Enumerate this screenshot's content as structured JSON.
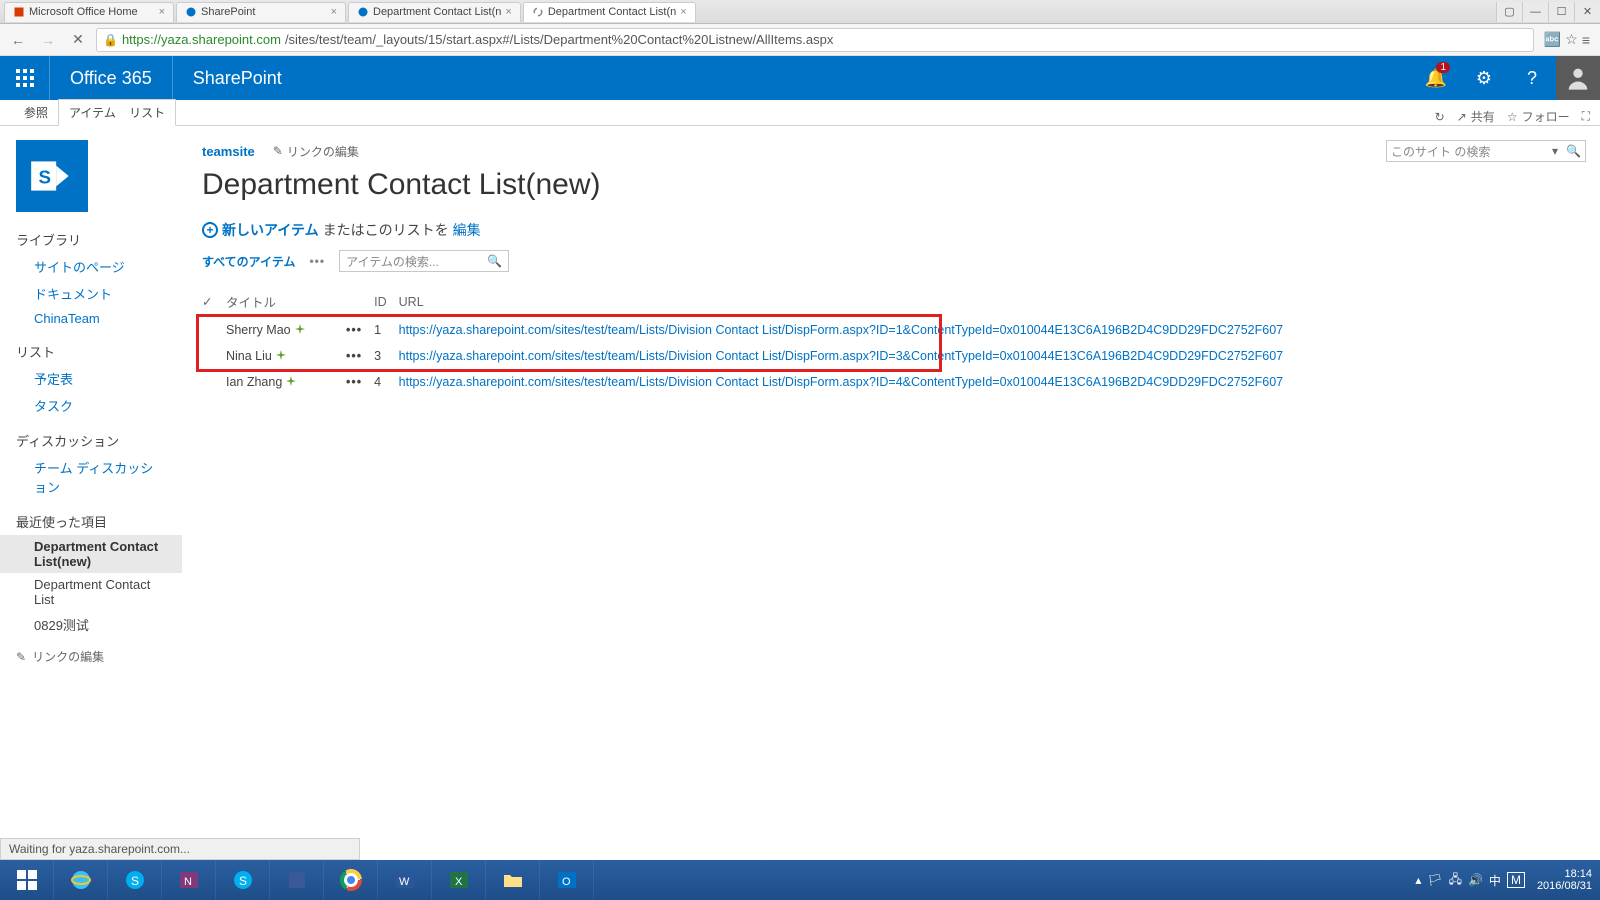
{
  "browser": {
    "tabs": [
      {
        "label": "Microsoft Office Home",
        "icon": "office"
      },
      {
        "label": "SharePoint",
        "icon": "sp"
      },
      {
        "label": "Department Contact List(n",
        "icon": "sp"
      },
      {
        "label": "Department Contact List(n",
        "icon": "loading",
        "active": true
      }
    ],
    "url_host": "https://yaza.sharepoint.com",
    "url_path": "/sites/test/team/_layouts/15/start.aspx#/Lists/Department%20Contact%20Listnew/AllItems.aspx",
    "status_text": "Waiting for yaza.sharepoint.com..."
  },
  "suite": {
    "brand": "Office 365",
    "app": "SharePoint",
    "notif_count": "1"
  },
  "ribbon": {
    "tabs": [
      "参照",
      "アイテム",
      "リスト"
    ],
    "share": "共有",
    "follow": "フォロー"
  },
  "breadcrumb": {
    "site": "teamsite",
    "edit_links": "リンクの編集"
  },
  "page_title": "Department Contact List(new)",
  "site_search_placeholder": "このサイト の検索",
  "new_item": {
    "link": "新しいアイテム",
    "middle": "またはこのリストを",
    "edit": "編集"
  },
  "views": {
    "current": "すべてのアイテム",
    "item_search_placeholder": "アイテムの検索..."
  },
  "left_nav": {
    "h_library": "ライブラリ",
    "lib_items": [
      "サイトのページ",
      "ドキュメント",
      "ChinaTeam"
    ],
    "h_list": "リスト",
    "list_items": [
      "予定表",
      "タスク"
    ],
    "h_discussion": "ディスカッション",
    "disc_items": [
      "チーム ディスカッション"
    ],
    "h_recent": "最近使った項目",
    "recent_items": [
      "Department Contact List(new)",
      "Department Contact List",
      "0829测试"
    ],
    "edit_links": "リンクの編集"
  },
  "list": {
    "cols": {
      "check": "✓",
      "title": "タイトル",
      "id": "ID",
      "url": "URL"
    },
    "rows": [
      {
        "title": "Sherry Mao",
        "id": "1",
        "url": "https://yaza.sharepoint.com/sites/test/team/Lists/Division Contact List/DispForm.aspx?ID=1&ContentTypeId=0x010044E13C6A196B2D4C9DD29FDC2752F607"
      },
      {
        "title": "Nina Liu",
        "id": "3",
        "url": "https://yaza.sharepoint.com/sites/test/team/Lists/Division Contact List/DispForm.aspx?ID=3&ContentTypeId=0x010044E13C6A196B2D4C9DD29FDC2752F607"
      },
      {
        "title": "Ian Zhang",
        "id": "4",
        "url": "https://yaza.sharepoint.com/sites/test/team/Lists/Division Contact List/DispForm.aspx?ID=4&ContentTypeId=0x010044E13C6A196B2D4C9DD29FDC2752F607"
      }
    ]
  },
  "taskbar": {
    "time": "18:14",
    "date": "2016/08/31",
    "ime": "中",
    "m_box": "M"
  }
}
